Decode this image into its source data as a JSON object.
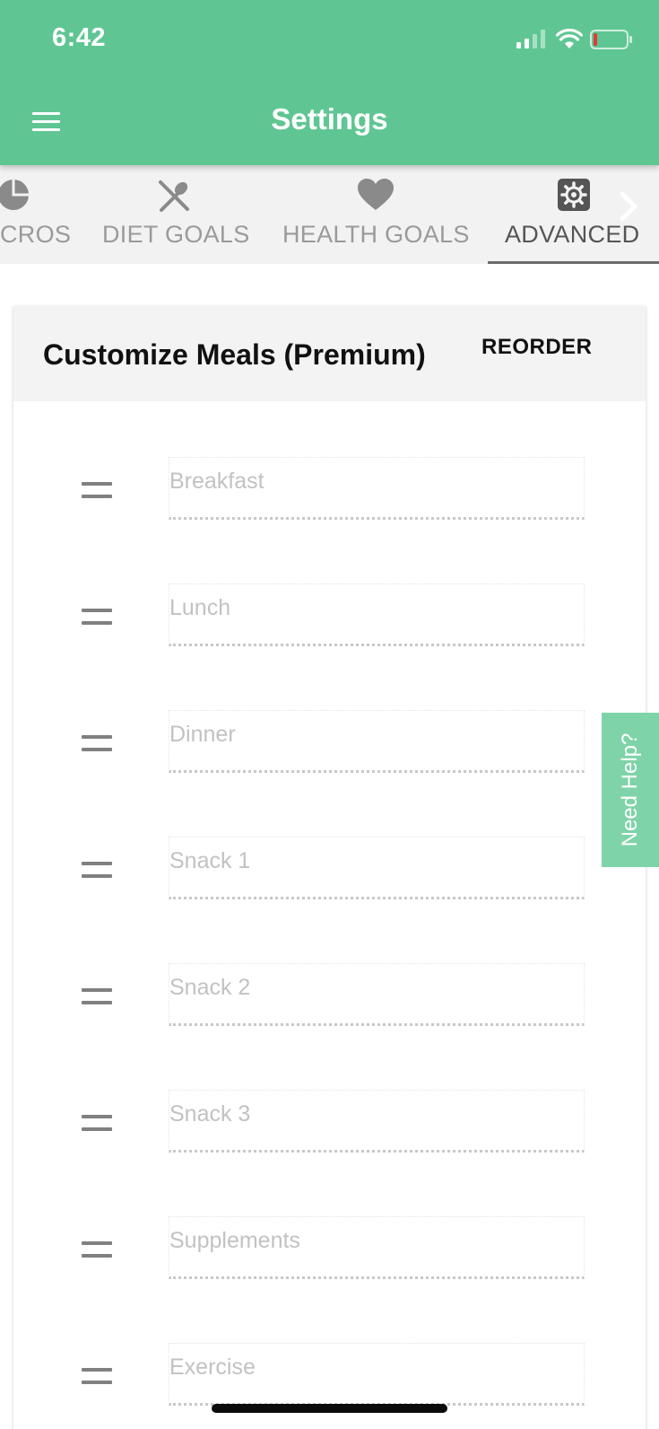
{
  "status_bar": {
    "time": "6:42"
  },
  "app_bar": {
    "title": "Settings"
  },
  "tabs": [
    {
      "label": "CROS",
      "icon": "pie-chart-icon",
      "active": false
    },
    {
      "label": "DIET GOALS",
      "icon": "fork-spoon-icon",
      "active": false
    },
    {
      "label": "HEALTH GOALS",
      "icon": "heart-icon",
      "active": false
    },
    {
      "label": "ADVANCED",
      "icon": "gear-icon",
      "active": true
    }
  ],
  "card": {
    "title": "Customize Meals (Premium)",
    "reorder_label": "REORDER",
    "meals": [
      {
        "placeholder": "Breakfast"
      },
      {
        "placeholder": "Lunch"
      },
      {
        "placeholder": "Dinner"
      },
      {
        "placeholder": "Snack 1"
      },
      {
        "placeholder": "Snack 2"
      },
      {
        "placeholder": "Snack 3"
      },
      {
        "placeholder": "Supplements"
      },
      {
        "placeholder": "Exercise"
      }
    ]
  },
  "help_tab": {
    "label": "Need Help?"
  },
  "colors": {
    "header_green": "#5fc693",
    "help_green": "#7fd3a9",
    "battery_low": "#e53935"
  }
}
